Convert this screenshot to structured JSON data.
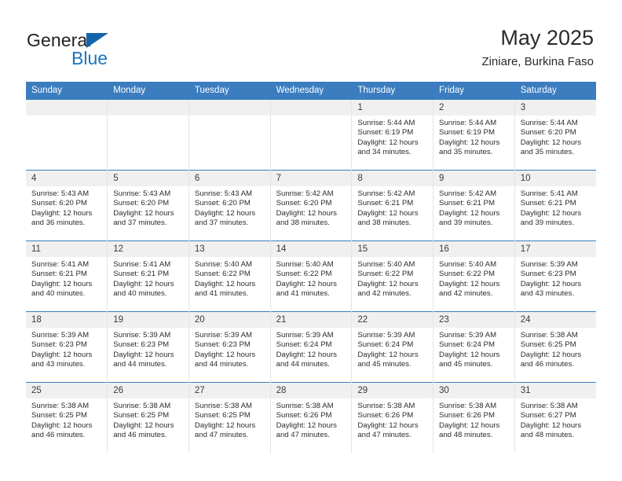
{
  "brand": {
    "name_top": "General",
    "name_bottom": "Blue",
    "color_black": "#231f20",
    "color_blue": "#1b75bc"
  },
  "header": {
    "title": "May 2025",
    "subtitle": "Ziniare, Burkina Faso"
  },
  "theme": {
    "header_bg": "#3b7dbf",
    "header_text": "#ffffff",
    "daynum_bg": "#f0f0f0",
    "cell_bg": "#ffffff",
    "row_divider": "#3b7dbf"
  },
  "weekdays": [
    "Sunday",
    "Monday",
    "Tuesday",
    "Wednesday",
    "Thursday",
    "Friday",
    "Saturday"
  ],
  "weeks": [
    [
      {
        "day": "",
        "blank": true,
        "sunrise": "",
        "sunset": "",
        "daylight_a": "",
        "daylight_b": ""
      },
      {
        "day": "",
        "blank": true,
        "sunrise": "",
        "sunset": "",
        "daylight_a": "",
        "daylight_b": ""
      },
      {
        "day": "",
        "blank": true,
        "sunrise": "",
        "sunset": "",
        "daylight_a": "",
        "daylight_b": ""
      },
      {
        "day": "",
        "blank": true,
        "sunrise": "",
        "sunset": "",
        "daylight_a": "",
        "daylight_b": ""
      },
      {
        "day": "1",
        "blank": false,
        "sunrise": "Sunrise: 5:44 AM",
        "sunset": "Sunset: 6:19 PM",
        "daylight_a": "Daylight: 12 hours",
        "daylight_b": "and 34 minutes."
      },
      {
        "day": "2",
        "blank": false,
        "sunrise": "Sunrise: 5:44 AM",
        "sunset": "Sunset: 6:19 PM",
        "daylight_a": "Daylight: 12 hours",
        "daylight_b": "and 35 minutes."
      },
      {
        "day": "3",
        "blank": false,
        "sunrise": "Sunrise: 5:44 AM",
        "sunset": "Sunset: 6:20 PM",
        "daylight_a": "Daylight: 12 hours",
        "daylight_b": "and 35 minutes."
      }
    ],
    [
      {
        "day": "4",
        "blank": false,
        "sunrise": "Sunrise: 5:43 AM",
        "sunset": "Sunset: 6:20 PM",
        "daylight_a": "Daylight: 12 hours",
        "daylight_b": "and 36 minutes."
      },
      {
        "day": "5",
        "blank": false,
        "sunrise": "Sunrise: 5:43 AM",
        "sunset": "Sunset: 6:20 PM",
        "daylight_a": "Daylight: 12 hours",
        "daylight_b": "and 37 minutes."
      },
      {
        "day": "6",
        "blank": false,
        "sunrise": "Sunrise: 5:43 AM",
        "sunset": "Sunset: 6:20 PM",
        "daylight_a": "Daylight: 12 hours",
        "daylight_b": "and 37 minutes."
      },
      {
        "day": "7",
        "blank": false,
        "sunrise": "Sunrise: 5:42 AM",
        "sunset": "Sunset: 6:20 PM",
        "daylight_a": "Daylight: 12 hours",
        "daylight_b": "and 38 minutes."
      },
      {
        "day": "8",
        "blank": false,
        "sunrise": "Sunrise: 5:42 AM",
        "sunset": "Sunset: 6:21 PM",
        "daylight_a": "Daylight: 12 hours",
        "daylight_b": "and 38 minutes."
      },
      {
        "day": "9",
        "blank": false,
        "sunrise": "Sunrise: 5:42 AM",
        "sunset": "Sunset: 6:21 PM",
        "daylight_a": "Daylight: 12 hours",
        "daylight_b": "and 39 minutes."
      },
      {
        "day": "10",
        "blank": false,
        "sunrise": "Sunrise: 5:41 AM",
        "sunset": "Sunset: 6:21 PM",
        "daylight_a": "Daylight: 12 hours",
        "daylight_b": "and 39 minutes."
      }
    ],
    [
      {
        "day": "11",
        "blank": false,
        "sunrise": "Sunrise: 5:41 AM",
        "sunset": "Sunset: 6:21 PM",
        "daylight_a": "Daylight: 12 hours",
        "daylight_b": "and 40 minutes."
      },
      {
        "day": "12",
        "blank": false,
        "sunrise": "Sunrise: 5:41 AM",
        "sunset": "Sunset: 6:21 PM",
        "daylight_a": "Daylight: 12 hours",
        "daylight_b": "and 40 minutes."
      },
      {
        "day": "13",
        "blank": false,
        "sunrise": "Sunrise: 5:40 AM",
        "sunset": "Sunset: 6:22 PM",
        "daylight_a": "Daylight: 12 hours",
        "daylight_b": "and 41 minutes."
      },
      {
        "day": "14",
        "blank": false,
        "sunrise": "Sunrise: 5:40 AM",
        "sunset": "Sunset: 6:22 PM",
        "daylight_a": "Daylight: 12 hours",
        "daylight_b": "and 41 minutes."
      },
      {
        "day": "15",
        "blank": false,
        "sunrise": "Sunrise: 5:40 AM",
        "sunset": "Sunset: 6:22 PM",
        "daylight_a": "Daylight: 12 hours",
        "daylight_b": "and 42 minutes."
      },
      {
        "day": "16",
        "blank": false,
        "sunrise": "Sunrise: 5:40 AM",
        "sunset": "Sunset: 6:22 PM",
        "daylight_a": "Daylight: 12 hours",
        "daylight_b": "and 42 minutes."
      },
      {
        "day": "17",
        "blank": false,
        "sunrise": "Sunrise: 5:39 AM",
        "sunset": "Sunset: 6:23 PM",
        "daylight_a": "Daylight: 12 hours",
        "daylight_b": "and 43 minutes."
      }
    ],
    [
      {
        "day": "18",
        "blank": false,
        "sunrise": "Sunrise: 5:39 AM",
        "sunset": "Sunset: 6:23 PM",
        "daylight_a": "Daylight: 12 hours",
        "daylight_b": "and 43 minutes."
      },
      {
        "day": "19",
        "blank": false,
        "sunrise": "Sunrise: 5:39 AM",
        "sunset": "Sunset: 6:23 PM",
        "daylight_a": "Daylight: 12 hours",
        "daylight_b": "and 44 minutes."
      },
      {
        "day": "20",
        "blank": false,
        "sunrise": "Sunrise: 5:39 AM",
        "sunset": "Sunset: 6:23 PM",
        "daylight_a": "Daylight: 12 hours",
        "daylight_b": "and 44 minutes."
      },
      {
        "day": "21",
        "blank": false,
        "sunrise": "Sunrise: 5:39 AM",
        "sunset": "Sunset: 6:24 PM",
        "daylight_a": "Daylight: 12 hours",
        "daylight_b": "and 44 minutes."
      },
      {
        "day": "22",
        "blank": false,
        "sunrise": "Sunrise: 5:39 AM",
        "sunset": "Sunset: 6:24 PM",
        "daylight_a": "Daylight: 12 hours",
        "daylight_b": "and 45 minutes."
      },
      {
        "day": "23",
        "blank": false,
        "sunrise": "Sunrise: 5:39 AM",
        "sunset": "Sunset: 6:24 PM",
        "daylight_a": "Daylight: 12 hours",
        "daylight_b": "and 45 minutes."
      },
      {
        "day": "24",
        "blank": false,
        "sunrise": "Sunrise: 5:38 AM",
        "sunset": "Sunset: 6:25 PM",
        "daylight_a": "Daylight: 12 hours",
        "daylight_b": "and 46 minutes."
      }
    ],
    [
      {
        "day": "25",
        "blank": false,
        "sunrise": "Sunrise: 5:38 AM",
        "sunset": "Sunset: 6:25 PM",
        "daylight_a": "Daylight: 12 hours",
        "daylight_b": "and 46 minutes."
      },
      {
        "day": "26",
        "blank": false,
        "sunrise": "Sunrise: 5:38 AM",
        "sunset": "Sunset: 6:25 PM",
        "daylight_a": "Daylight: 12 hours",
        "daylight_b": "and 46 minutes."
      },
      {
        "day": "27",
        "blank": false,
        "sunrise": "Sunrise: 5:38 AM",
        "sunset": "Sunset: 6:25 PM",
        "daylight_a": "Daylight: 12 hours",
        "daylight_b": "and 47 minutes."
      },
      {
        "day": "28",
        "blank": false,
        "sunrise": "Sunrise: 5:38 AM",
        "sunset": "Sunset: 6:26 PM",
        "daylight_a": "Daylight: 12 hours",
        "daylight_b": "and 47 minutes."
      },
      {
        "day": "29",
        "blank": false,
        "sunrise": "Sunrise: 5:38 AM",
        "sunset": "Sunset: 6:26 PM",
        "daylight_a": "Daylight: 12 hours",
        "daylight_b": "and 47 minutes."
      },
      {
        "day": "30",
        "blank": false,
        "sunrise": "Sunrise: 5:38 AM",
        "sunset": "Sunset: 6:26 PM",
        "daylight_a": "Daylight: 12 hours",
        "daylight_b": "and 48 minutes."
      },
      {
        "day": "31",
        "blank": false,
        "sunrise": "Sunrise: 5:38 AM",
        "sunset": "Sunset: 6:27 PM",
        "daylight_a": "Daylight: 12 hours",
        "daylight_b": "and 48 minutes."
      }
    ]
  ]
}
